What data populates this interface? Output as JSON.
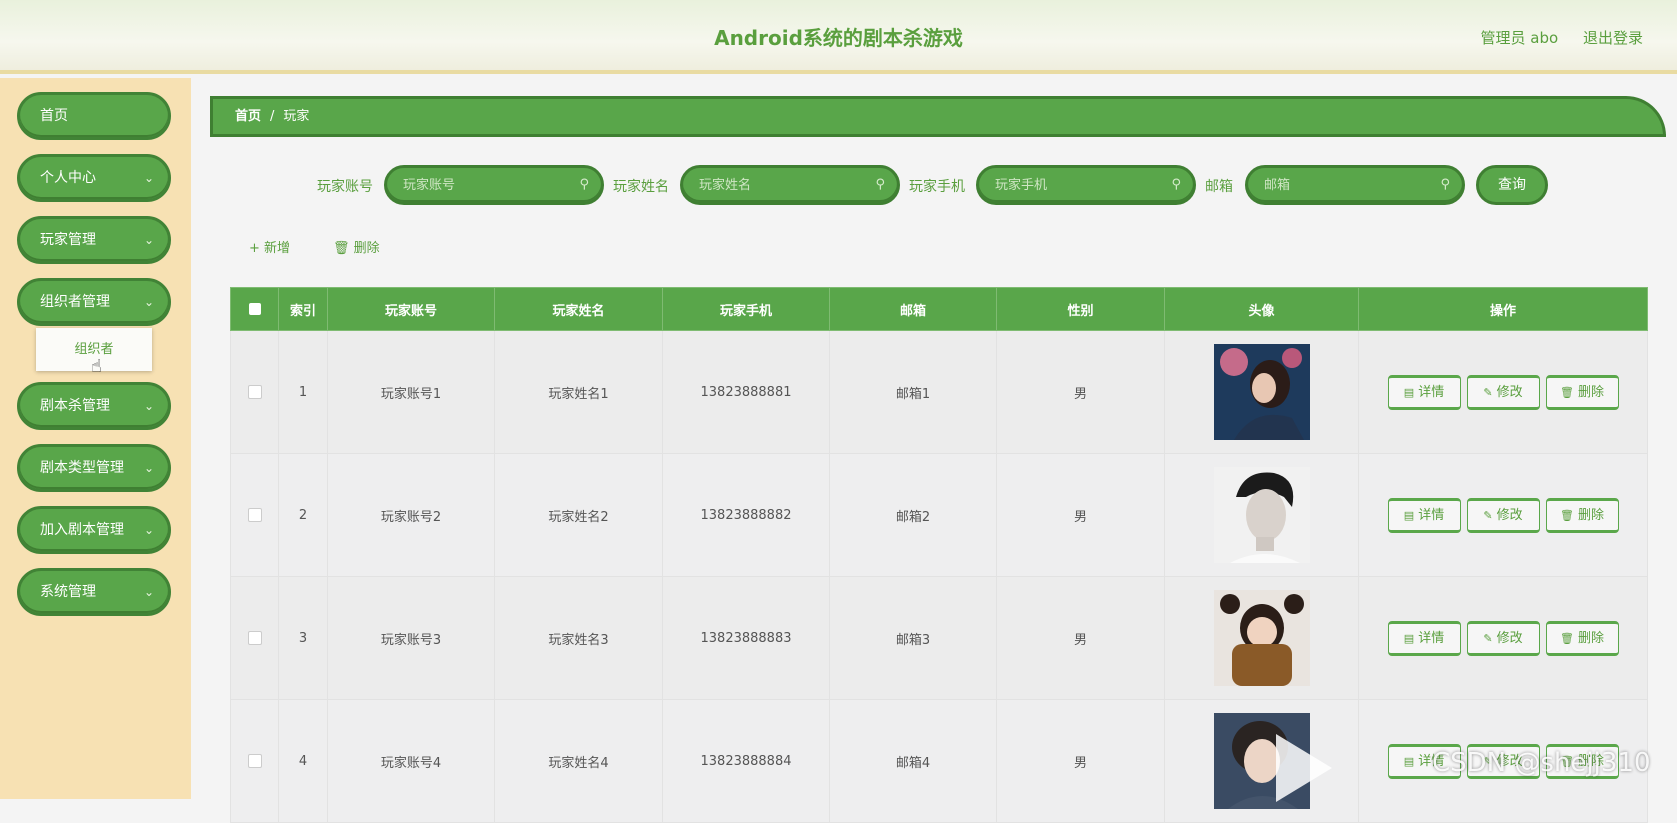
{
  "header": {
    "title": "Android系统的剧本杀游戏",
    "user_label": "管理员 abo",
    "logout_label": "退出登录"
  },
  "sidebar": {
    "items": [
      {
        "label": "首页",
        "has_arrow": false
      },
      {
        "label": "个人中心",
        "has_arrow": true
      },
      {
        "label": "玩家管理",
        "has_arrow": true
      },
      {
        "label": "组织者管理",
        "has_arrow": true
      },
      {
        "label": "剧本杀管理",
        "has_arrow": true
      },
      {
        "label": "剧本类型管理",
        "has_arrow": true
      },
      {
        "label": "加入剧本管理",
        "has_arrow": true
      },
      {
        "label": "系统管理",
        "has_arrow": true
      }
    ],
    "submenu_item": "组织者"
  },
  "breadcrumb": {
    "home": "首页",
    "separator": "/",
    "current": "玩家"
  },
  "search": {
    "fields": [
      {
        "label": "玩家账号",
        "placeholder": "玩家账号"
      },
      {
        "label": "玩家姓名",
        "placeholder": "玩家姓名"
      },
      {
        "label": "玩家手机",
        "placeholder": "玩家手机"
      },
      {
        "label": "邮箱",
        "placeholder": "邮箱"
      }
    ],
    "query_label": "查询"
  },
  "actions": {
    "add_label": "新增",
    "delete_label": "删除"
  },
  "table": {
    "headers": [
      "索引",
      "玩家账号",
      "玩家姓名",
      "玩家手机",
      "邮箱",
      "性别",
      "头像",
      "操作"
    ],
    "rows": [
      {
        "index": "1",
        "account": "玩家账号1",
        "name": "玩家姓名1",
        "phone": "13823888881",
        "email": "邮箱1",
        "gender": "男"
      },
      {
        "index": "2",
        "account": "玩家账号2",
        "name": "玩家姓名2",
        "phone": "13823888882",
        "email": "邮箱2",
        "gender": "男"
      },
      {
        "index": "3",
        "account": "玩家账号3",
        "name": "玩家姓名3",
        "phone": "13823888883",
        "email": "邮箱3",
        "gender": "男"
      },
      {
        "index": "4",
        "account": "玩家账号4",
        "name": "玩家姓名4",
        "phone": "13823888884",
        "email": "邮箱4",
        "gender": "男"
      }
    ],
    "row_actions": {
      "detail": "详情",
      "edit": "修改",
      "delete": "删除"
    }
  },
  "watermark": "CSDN @shejj310",
  "colors": {
    "primary": "#59a64a",
    "primary_dark": "#3f7f32",
    "sidebar_bg": "#f7e1b3",
    "title": "#5a9f3e"
  }
}
